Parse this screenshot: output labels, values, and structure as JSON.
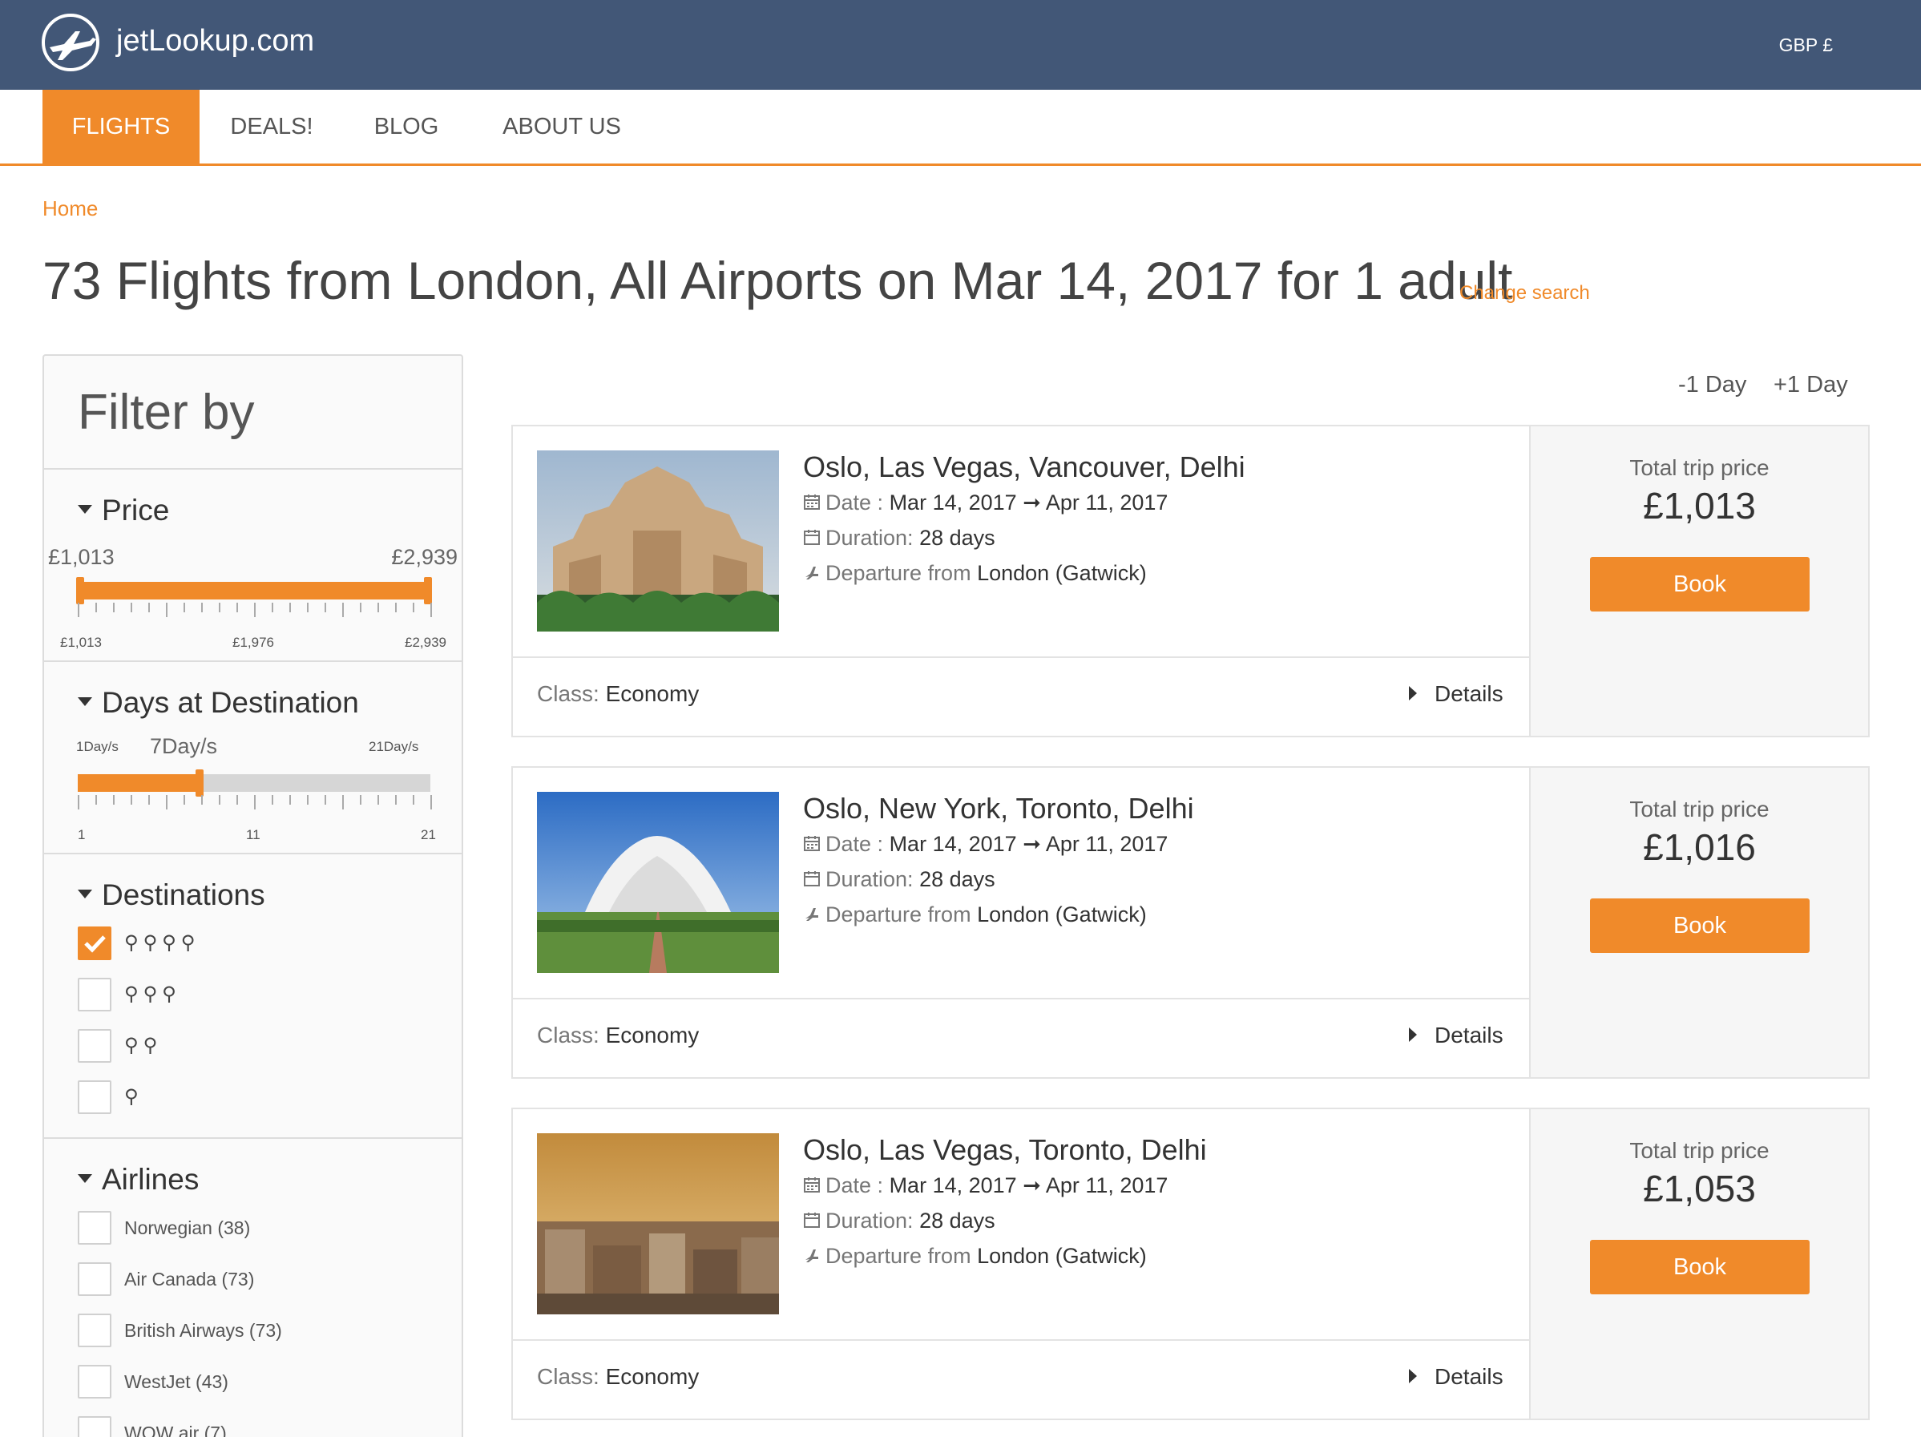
{
  "header": {
    "brand": "jetLookup.com",
    "currency": "GBP £"
  },
  "nav": {
    "items": [
      {
        "label": "FLIGHTS"
      },
      {
        "label": "DEALS!"
      },
      {
        "label": "BLOG"
      },
      {
        "label": "ABOUT US"
      }
    ]
  },
  "breadcrumb": {
    "home": "Home"
  },
  "search": {
    "heading": "73 Flights from London, All Airports on Mar 14, 2017 for 1 adult",
    "change_label": "Change search"
  },
  "filters": {
    "title": "Filter by",
    "price": {
      "title": "Price",
      "min_value": "£1,013",
      "max_value": "£2,939",
      "scale": [
        "£1,013",
        "£1,976",
        "£2,939"
      ]
    },
    "days": {
      "title": "Days at Destination",
      "min_label": "1Day/s",
      "current_label": "7Day/s",
      "max_label": "21Day/s",
      "scale": [
        "1",
        "11",
        "21"
      ],
      "min": 1,
      "max": 21,
      "value": 7
    },
    "destinations": {
      "title": "Destinations",
      "options": [
        {
          "pins": "4",
          "checked": true
        },
        {
          "pins": "3",
          "checked": false
        },
        {
          "pins": "2",
          "checked": false
        },
        {
          "pins": "1",
          "checked": false
        }
      ]
    },
    "airlines": {
      "title": "Airlines",
      "options": [
        {
          "label": "Norwegian (38)"
        },
        {
          "label": "Air Canada (73)"
        },
        {
          "label": "British Airways (73)"
        },
        {
          "label": "WestJet (43)"
        },
        {
          "label": "WOW air (7)"
        }
      ]
    }
  },
  "day_nav": {
    "prev": "-1 Day",
    "next": "+1 Day"
  },
  "labels": {
    "date": "Date :",
    "duration": "Duration:",
    "departure": "Departure from",
    "class": "Class:",
    "details": "Details",
    "total": "Total trip price",
    "book": "Book",
    "arrow": "➞"
  },
  "results": [
    {
      "route": "Oslo, Las Vegas, Vancouver, Delhi",
      "date_from": "Mar 14, 2017",
      "date_to": "Apr 11, 2017",
      "duration": "28 days",
      "departure": "London (Gatwick)",
      "class": "Economy",
      "price": "£1,013"
    },
    {
      "route": "Oslo, New York, Toronto, Delhi",
      "date_from": "Mar 14, 2017",
      "date_to": "Apr 11, 2017",
      "duration": "28 days",
      "departure": "London (Gatwick)",
      "class": "Economy",
      "price": "£1,016"
    },
    {
      "route": "Oslo, Las Vegas, Toronto, Delhi",
      "date_from": "Mar 14, 2017",
      "date_to": "Apr 11, 2017",
      "duration": "28 days",
      "departure": "London (Gatwick)",
      "class": "Economy",
      "price": "£1,053"
    }
  ],
  "colors": {
    "header": "#425777",
    "accent": "#f08a2a"
  }
}
